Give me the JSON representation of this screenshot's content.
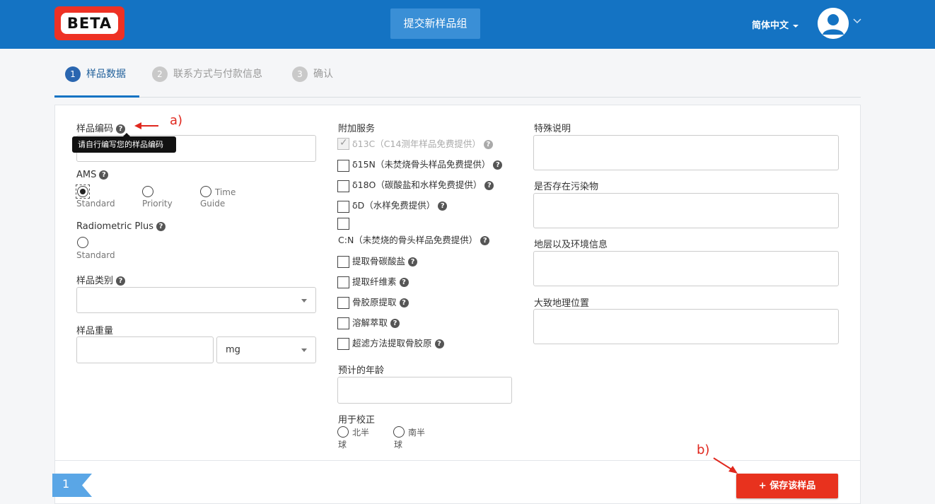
{
  "header": {
    "logo_text": "BETA",
    "submit_tab": "提交新样品组",
    "language": "简体中文"
  },
  "steps": [
    {
      "num": "1",
      "label": "样品数据"
    },
    {
      "num": "2",
      "label": "联系方式与付款信息"
    },
    {
      "num": "3",
      "label": "确认"
    }
  ],
  "left": {
    "sample_code_label": "样品编码",
    "sample_code_tooltip": "请自行编写您的样品编码",
    "ams_label": "AMS",
    "ams_options": [
      {
        "line1": "Standard",
        "line2": ""
      },
      {
        "line1": "Priority",
        "line2": ""
      },
      {
        "line1": "Time",
        "line2": "Guide"
      }
    ],
    "radiometric_label": "Radiometric Plus",
    "radiometric_option": "Standard",
    "sample_type_label": "样品类别",
    "sample_type_value": "",
    "weight_label": "样品重量",
    "weight_unit": "mg"
  },
  "middle": {
    "extra_services_label": "附加服务",
    "services": [
      "δ13C（C14测年样品免费提供）",
      "δ15N（未焚烧骨头样品免费提供）",
      "δ18O（碳酸盐和水样免费提供）",
      "δD（水样免费提供）",
      "C:N（未焚烧的骨头样品免费提供）",
      "提取骨碳酸盐",
      "提取纤维素",
      "骨胶原提取",
      "溶解萃取",
      "超滤方法提取骨胶原"
    ],
    "expected_age_label": "预计的年龄",
    "calibration_label": "用于校正",
    "calibration_options": [
      {
        "line1": "北半",
        "line2": "球"
      },
      {
        "line1": "南半",
        "line2": "球"
      }
    ]
  },
  "right": {
    "special_notes_label": "特殊说明",
    "contamination_label": "是否存在污染物",
    "stratigraphy_label": "地层以及环境信息",
    "location_label": "大致地理位置"
  },
  "annotations": {
    "a": "a)",
    "b": "b)"
  },
  "footer": {
    "page_number": "1",
    "save_button": "+ 保存该样品"
  },
  "colors": {
    "header": "#1473c3",
    "accent": "#e8321e"
  }
}
